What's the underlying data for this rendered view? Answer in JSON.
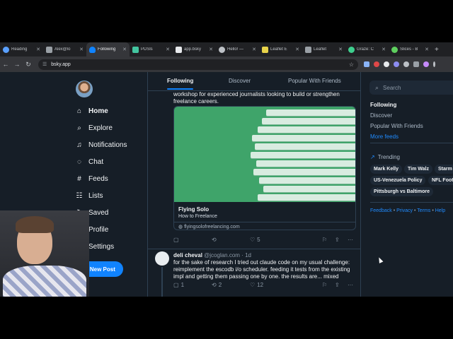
{
  "browser": {
    "tabs": [
      {
        "title": "Reading",
        "color": "#5aa0ff",
        "active": false
      },
      {
        "title": "Alex@lo",
        "color": "#9aa0a6",
        "active": false
      },
      {
        "title": "Following",
        "color": "#1083fe",
        "active": true
      },
      {
        "title": "PDSls",
        "color": "#43c5a0",
        "active": false
      },
      {
        "title": "app.bsky",
        "color": "#e8eaed",
        "active": false
      },
      {
        "title": "Hello! —",
        "color": "#bdc1c6",
        "active": false
      },
      {
        "title": "Leaflet E",
        "color": "#e8d34a",
        "active": false
      },
      {
        "title": "Leaflet",
        "color": "#9aa0a6",
        "active": false
      },
      {
        "title": "Graze: C",
        "color": "#3ecf8e",
        "active": false
      },
      {
        "title": "Slices - B",
        "color": "#5ecf5e",
        "active": false
      }
    ],
    "url": "bsky.app"
  },
  "nav": {
    "home": "Home",
    "explore": "Explore",
    "notifications": "Notifications",
    "chat": "Chat",
    "feeds": "Feeds",
    "lists": "Lists",
    "saved": "Saved",
    "profile": "Profile",
    "settings": "Settings",
    "new_post": "New Post"
  },
  "feed_tabs": {
    "following": "Following",
    "discover": "Discover",
    "popular": "Popular With Friends"
  },
  "post1": {
    "text_line1": "workshop for experienced journalists looking to build or strengthen",
    "text_line2": "freelance careers.",
    "card": {
      "title": "Flying Solo",
      "description": "How to Freelance",
      "domain": "flyingsolofreelancing.com"
    },
    "likes": "5"
  },
  "post2": {
    "author_name": "deli cheval",
    "author_handle": "@jcoglan.com · 1d",
    "text_line1": "for the sake of research I tried out claude code on my usual challenge:",
    "text_line2": "reimplement the escodb i/o scheduler. feeding it tests from the existing",
    "text_line3": "impl and getting them passing one by one. the results are... mixed",
    "replies": "1",
    "reposts": "2",
    "likes": "12"
  },
  "right": {
    "search_placeholder": "Search",
    "feeds": [
      "Following",
      "Discover",
      "Popular With Friends"
    ],
    "more_feeds": "More feeds",
    "trending_title": "Trending",
    "trending": [
      "Mark Kelly",
      "Tim Walz",
      "Starm",
      "US-Venezuela Policy",
      "NFL Foot",
      "Pittsburgh vs Baltimore"
    ],
    "footer": {
      "feedback": "Feedback",
      "privacy": "Privacy",
      "terms": "Terms",
      "help": "Help"
    }
  }
}
